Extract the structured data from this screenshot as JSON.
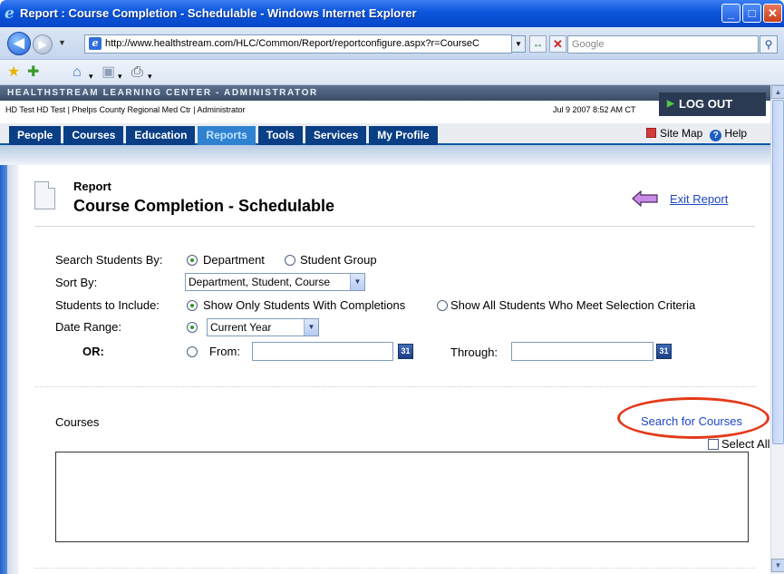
{
  "window": {
    "title": "Report : Course Completion - Schedulable - Windows Internet Explorer"
  },
  "browser": {
    "url": "http://www.healthstream.com/HLC/Common/Report/reportconfigure.aspx?r=CourseC",
    "search_placeholder": "Google"
  },
  "header": {
    "brand": "HEALTHSTREAM LEARNING CENTER - ADMINISTRATOR",
    "logout_label": "LOG OUT",
    "user_info": "HD Test HD Test | Phelps County Regional Med Ctr | Administrator",
    "datetime": "Jul 9 2007 8:52 AM CT"
  },
  "nav": {
    "tabs": [
      {
        "label": "People"
      },
      {
        "label": "Courses"
      },
      {
        "label": "Education"
      },
      {
        "label": "Reports",
        "active": true
      },
      {
        "label": "Tools"
      },
      {
        "label": "Services"
      },
      {
        "label": "My Profile"
      }
    ],
    "site_map": "Site Map",
    "help": "Help"
  },
  "report": {
    "kicker": "Report",
    "title": "Course Completion - Schedulable",
    "exit_label": "Exit Report"
  },
  "form": {
    "search_by_label": "Search Students By:",
    "search_by_options": [
      "Department",
      "Student Group"
    ],
    "search_by_selected": "Department",
    "sort_by_label": "Sort By:",
    "sort_by_value": "Department, Student, Course",
    "include_label": "Students to Include:",
    "include_options": [
      "Show Only Students With Completions",
      "Show All Students Who Meet Selection Criteria"
    ],
    "include_selected": "Show Only Students With Completions",
    "date_range_label": "Date Range:",
    "date_range_value": "Current Year",
    "or_label": "OR:",
    "from_label": "From:",
    "through_label": "Through:",
    "calendar_day": "31"
  },
  "courses": {
    "label": "Courses",
    "search_link": "Search for Courses",
    "select_all": "Select All"
  },
  "colors": {
    "tab_bg": "#0a3f86",
    "tab_active": "#2f82d0",
    "link": "#1f46c7",
    "highlight_oval": "#e33a1a"
  }
}
